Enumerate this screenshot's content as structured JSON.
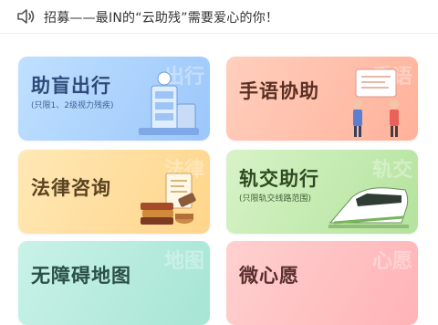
{
  "announcement": {
    "text": "招募——最IN的“云助残”需要爱心的你！"
  },
  "cards": [
    {
      "title": "助盲出行",
      "subtitle": "(只限1、2级视力残疾)",
      "watermark": "出行"
    },
    {
      "title": "手语协助",
      "subtitle": "",
      "watermark": "手语"
    },
    {
      "title": "法律咨询",
      "subtitle": "",
      "watermark": "法律"
    },
    {
      "title": "轨交助行",
      "subtitle": "(只限轨交线路范围)",
      "watermark": "轨交"
    },
    {
      "title": "无障碍地图",
      "subtitle": "",
      "watermark": "地图"
    },
    {
      "title": "微心愿",
      "subtitle": "",
      "watermark": "心愿"
    }
  ],
  "colors": {
    "blind_card": "#9cc7fb",
    "sign_card": "#ffb19a",
    "law_card": "#ffd58a",
    "rail_card": "#b4e39e",
    "map_card": "#a6e5d4",
    "wish_card": "#ffb3b7"
  }
}
